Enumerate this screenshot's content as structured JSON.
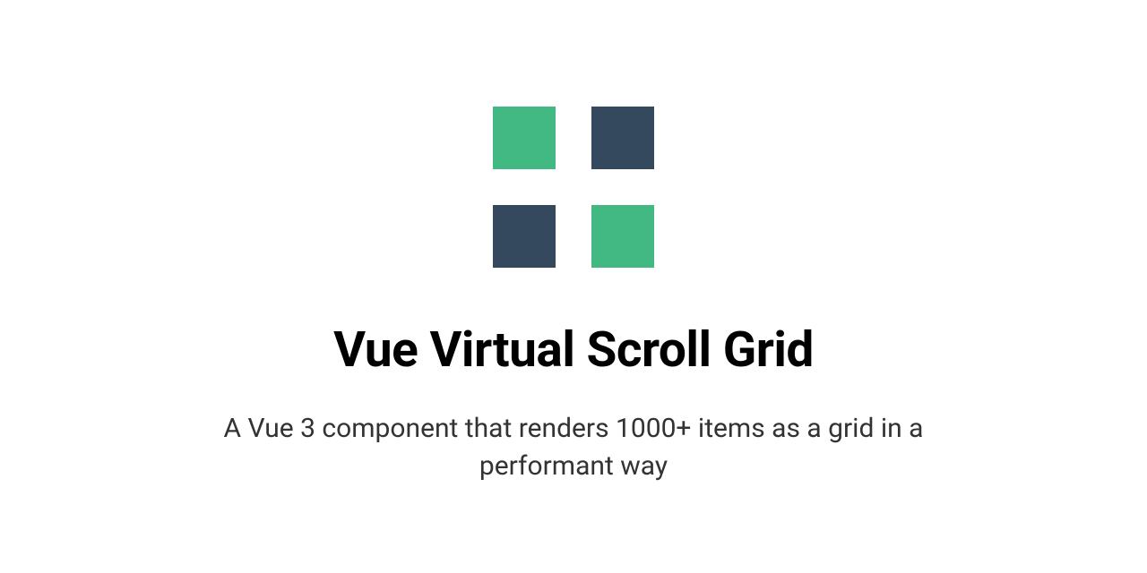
{
  "logo": {
    "colors": {
      "green": "#42b883",
      "dark": "#35495e"
    },
    "squares": [
      "green",
      "dark",
      "dark",
      "green"
    ]
  },
  "title": "Vue Virtual Scroll Grid",
  "subtitle": "A Vue 3 component that renders 1000+ items as a grid in a performant way"
}
